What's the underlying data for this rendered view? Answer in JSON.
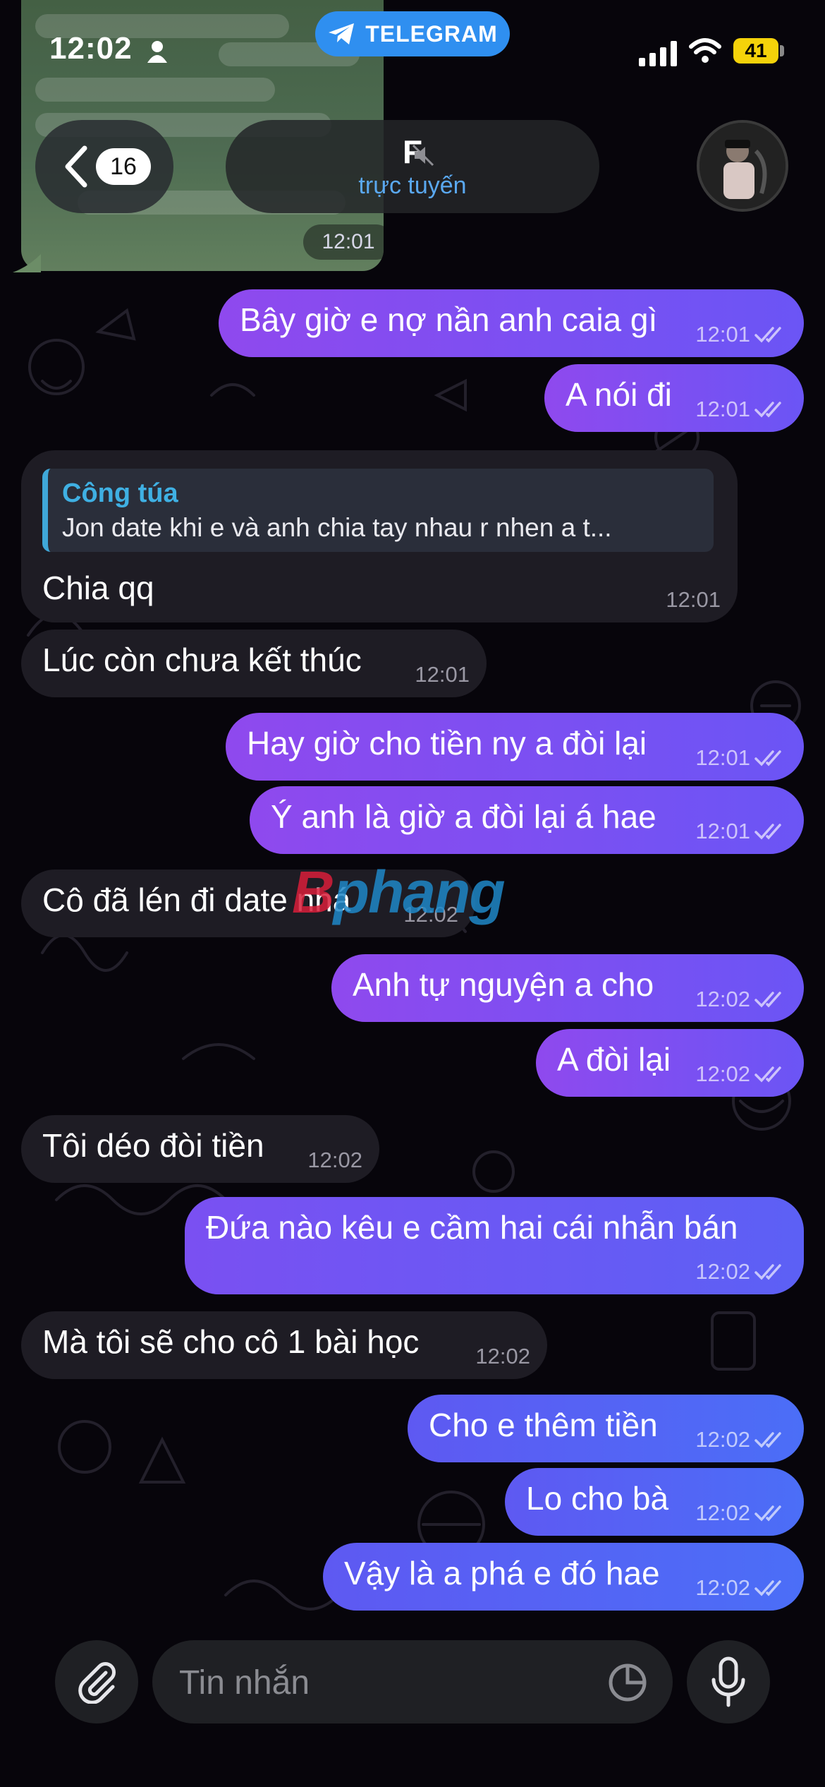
{
  "status_bar": {
    "time": "12:02",
    "battery": "41",
    "app_pill": "TELEGRAM"
  },
  "header": {
    "back_count": "16",
    "title": "F",
    "status": "trực tuyến"
  },
  "forwarded_screenshot": {
    "time": "12:01"
  },
  "reply": {
    "name": "Công túa",
    "text": "Jon date khi e và anh chia tay nhau r nhen a t..."
  },
  "messages": [
    {
      "text": "Bây giờ e nợ nần anh caia gì",
      "time": "12:01"
    },
    {
      "text": "A nói đi",
      "time": "12:01"
    },
    {
      "text": "Chia qq",
      "time": "12:01"
    },
    {
      "text": "Lúc còn chưa kết thúc",
      "time": "12:01"
    },
    {
      "text": "Hay giờ cho tiền ny a đòi lại",
      "time": "12:01"
    },
    {
      "text": "Ý anh là giờ a đòi lại á hae",
      "time": "12:01"
    },
    {
      "text": "Cô đã lén đi date nhá",
      "time": "12:02"
    },
    {
      "text": "Anh tự nguyện a cho",
      "time": "12:02"
    },
    {
      "text": "A đòi lại",
      "time": "12:02"
    },
    {
      "text": "Tôi déo đòi tiền",
      "time": "12:02"
    },
    {
      "text": "Đứa nào kêu e cầm hai cái nhẫn bán",
      "time": "12:02"
    },
    {
      "text": "Mà tôi sẽ cho cô 1 bài học",
      "time": "12:02"
    },
    {
      "text": "Cho e thêm tiền",
      "time": "12:02"
    },
    {
      "text": "Lo cho bà",
      "time": "12:02"
    },
    {
      "text": "Vậy là a phá e đó hae",
      "time": "12:02"
    }
  ],
  "watermark": {
    "first": "B",
    "rest": "phang"
  },
  "input": {
    "placeholder": "Tin nhắn"
  },
  "icons": {
    "person": "person-icon",
    "telegram": "telegram-plane-icon",
    "signal": "signal-icon",
    "wifi": "wifi-icon",
    "back": "chevron-left-icon",
    "mute": "mute-icon",
    "checks": "double-check-icon",
    "attach": "paperclip-icon",
    "sticker": "sticker-icon",
    "mic": "microphone-icon"
  },
  "colors": {
    "outgoing": "#8f49ee",
    "incoming": "#1e1c24",
    "accent": "#2f8ff0",
    "reply_accent": "#3fa7d8"
  }
}
